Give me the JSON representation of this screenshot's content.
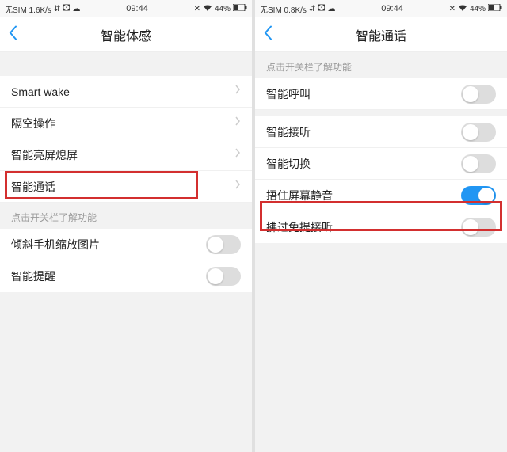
{
  "left": {
    "status": {
      "sim": "无SIM 1.6K/s",
      "time": "09:44",
      "battery": "44%"
    },
    "title": "智能体感",
    "group1": [
      {
        "label": "Smart wake"
      },
      {
        "label": "隔空操作"
      },
      {
        "label": "智能亮屏熄屏"
      },
      {
        "label": "智能通话"
      }
    ],
    "section_hint": "点击开关栏了解功能",
    "group2": [
      {
        "label": "倾斜手机缩放图片",
        "on": false
      },
      {
        "label": "智能提醒",
        "on": false
      }
    ]
  },
  "right": {
    "status": {
      "sim": "无SIM 0.8K/s",
      "time": "09:44",
      "battery": "44%"
    },
    "title": "智能通话",
    "section_hint": "点击开关栏了解功能",
    "items": [
      {
        "label": "智能呼叫",
        "on": false
      },
      {
        "label": "智能接听",
        "on": false
      },
      {
        "label": "智能切换",
        "on": false
      },
      {
        "label": "捂住屏幕静音",
        "on": true
      },
      {
        "label": "拂过免提接听",
        "on": false
      }
    ]
  }
}
